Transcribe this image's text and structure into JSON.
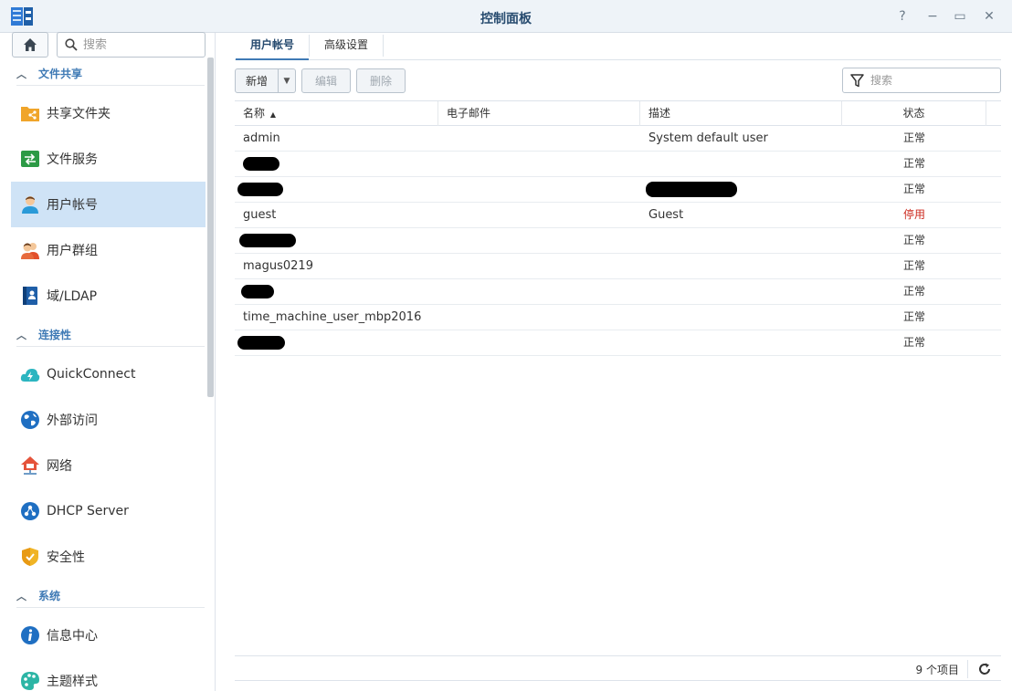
{
  "window": {
    "title": "控制面板",
    "buttons": {
      "help": "?",
      "minimize": "−",
      "maximize": "▭",
      "close": "✕"
    }
  },
  "sidebar": {
    "search_placeholder": "搜索",
    "sections": [
      {
        "label": "文件共享",
        "items": [
          {
            "label": "共享文件夹",
            "icon": "shared-folder-icon"
          },
          {
            "label": "文件服务",
            "icon": "file-services-icon"
          },
          {
            "label": "用户帐号",
            "icon": "user-icon",
            "active": true
          },
          {
            "label": "用户群组",
            "icon": "group-icon"
          },
          {
            "label": "域/LDAP",
            "icon": "ldap-icon"
          }
        ]
      },
      {
        "label": "连接性",
        "items": [
          {
            "label": "QuickConnect",
            "icon": "quickconnect-icon"
          },
          {
            "label": "外部访问",
            "icon": "globe-icon"
          },
          {
            "label": "网络",
            "icon": "network-icon"
          },
          {
            "label": "DHCP Server",
            "icon": "dhcp-icon"
          },
          {
            "label": "安全性",
            "icon": "shield-icon"
          }
        ]
      },
      {
        "label": "系统",
        "items": [
          {
            "label": "信息中心",
            "icon": "info-icon"
          },
          {
            "label": "主题样式",
            "icon": "palette-icon"
          }
        ]
      }
    ]
  },
  "main": {
    "tabs": [
      {
        "label": "用户帐号",
        "active": true
      },
      {
        "label": "高级设置",
        "active": false
      }
    ],
    "toolbar": {
      "add_label": "新增",
      "edit_label": "编辑",
      "delete_label": "删除",
      "filter_placeholder": "搜索"
    },
    "columns": [
      "名称",
      "电子邮件",
      "描述",
      "状态"
    ],
    "rows": [
      {
        "name": "admin",
        "email": "",
        "description": "System default user",
        "status": "正常"
      },
      {
        "name": "",
        "email": "",
        "description": "",
        "status": "正常",
        "redacted_name": true
      },
      {
        "name": "",
        "email": "",
        "description": "",
        "status": "正常",
        "redacted_name": true,
        "redacted_desc": true
      },
      {
        "name": "guest",
        "email": "",
        "description": "Guest",
        "status": "停用",
        "status_color": "#cc2a1f"
      },
      {
        "name": "",
        "email": "",
        "description": "",
        "status": "正常",
        "redacted_name": true
      },
      {
        "name": "magus0219",
        "email": "",
        "description": "",
        "status": "正常"
      },
      {
        "name": "",
        "email": "",
        "description": "",
        "status": "正常",
        "redacted_name": true
      },
      {
        "name": "time_machine_user_mbp2016",
        "email": "",
        "description": "",
        "status": "正常"
      },
      {
        "name": "",
        "email": "",
        "description": "",
        "status": "正常",
        "redacted_name": true
      }
    ],
    "footer": {
      "count": "9 个项目"
    }
  },
  "colors": {
    "accent": "#3f7ab5",
    "active_bg": "#cfe3f6",
    "disabled_status": "#cc2a1f"
  }
}
